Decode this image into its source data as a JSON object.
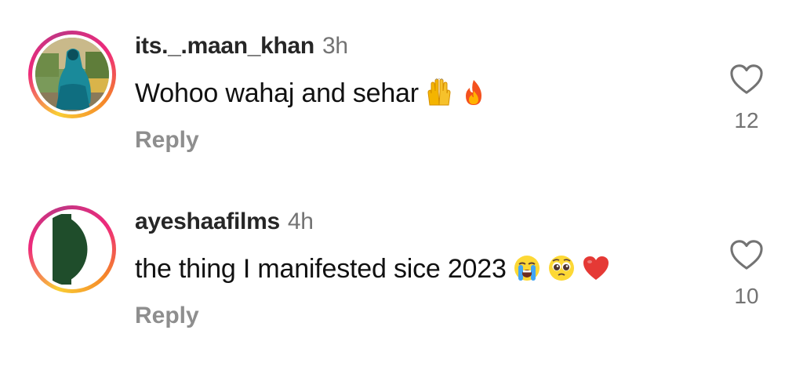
{
  "comments": [
    {
      "username": "its._.maan_khan",
      "time": "3h",
      "text": "Wohoo wahaj and sehar",
      "emojis": [
        "raising-hands-emoji",
        "fire-emoji"
      ],
      "reply_label": "Reply",
      "like_count": "12"
    },
    {
      "username": "ayeshaafilms",
      "time": "4h",
      "text": "the thing I manifested sice 2023",
      "emojis": [
        "loudly-crying-face-emoji",
        "pleading-face-emoji",
        "red-heart-emoji"
      ],
      "reply_label": "Reply",
      "like_count": "10"
    }
  ],
  "colors": {
    "username": "#262626",
    "timestamp": "#737373",
    "reply": "#8e8e8e",
    "heart_outline": "#737373",
    "ring_gradient": [
      "#f9ce34",
      "#ee2a7b",
      "#c13584"
    ],
    "avatar2_green": "#1f4d2b"
  }
}
